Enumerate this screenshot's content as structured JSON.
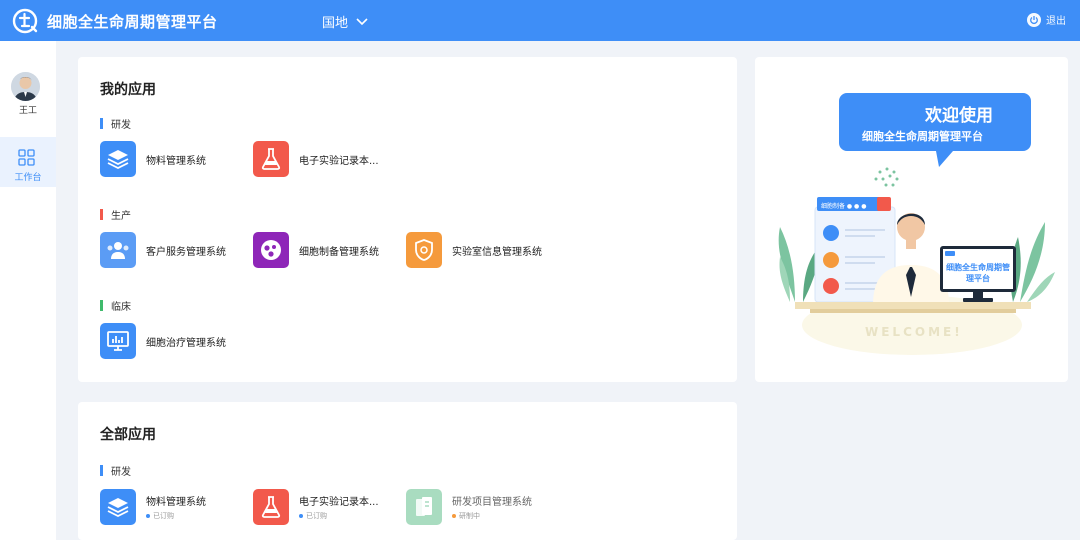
{
  "header": {
    "title": "细胞全生命周期管理平台",
    "region": "国地",
    "logout": "退出"
  },
  "sidebar": {
    "user_name": "王工",
    "items": [
      {
        "label": "工作台",
        "icon": "grid-icon"
      }
    ]
  },
  "my_apps": {
    "title": "我的应用",
    "sections": [
      {
        "label": "研发",
        "color": "#3e8ef7",
        "apps": [
          {
            "name": "物料管理系统",
            "icon": "layers-icon",
            "color": "#3e8ef7"
          },
          {
            "name": "电子实验记录本...",
            "icon": "flask-icon",
            "color": "#f2594b"
          }
        ]
      },
      {
        "label": "生产",
        "color": "#f2594b",
        "apps": [
          {
            "name": "客户服务管理系统",
            "icon": "users-icon",
            "color": "#5b9cf5"
          },
          {
            "name": "细胞制备管理系统",
            "icon": "cells-icon",
            "color": "#8e26b8"
          },
          {
            "name": "实验室信息管理系统",
            "icon": "shield-icon",
            "color": "#f59a3c"
          }
        ]
      },
      {
        "label": "临床",
        "color": "#3fba6c",
        "apps": [
          {
            "name": "细胞治疗管理系统",
            "icon": "monitor-chart-icon",
            "color": "#3e8ef7"
          }
        ]
      }
    ]
  },
  "all_apps": {
    "title": "全部应用",
    "sections": [
      {
        "label": "研发",
        "color": "#3e8ef7",
        "apps": [
          {
            "name": "物料管理系统",
            "status": "已订购",
            "status_color": "#3e8ef7",
            "icon": "layers-icon",
            "color": "#3e8ef7"
          },
          {
            "name": "电子实验记录本...",
            "status": "已订购",
            "status_color": "#3e8ef7",
            "icon": "flask-icon",
            "color": "#f2594b"
          },
          {
            "name": "研发项目管理系统",
            "status": "研制中",
            "status_color": "#f59a3c",
            "icon": "documents-icon",
            "color": "#a9dcc0"
          }
        ]
      }
    ]
  },
  "welcome": {
    "title": "欢迎使用",
    "subtitle": "细胞全生命周期管理平台",
    "monitor_text": "细胞全生命周期管理平台",
    "search_text": "细胞制备 ● ● ●",
    "footer": "WELCOME!"
  },
  "colors": {
    "brand": "#3e8ef7",
    "background": "#f0f3f8"
  }
}
